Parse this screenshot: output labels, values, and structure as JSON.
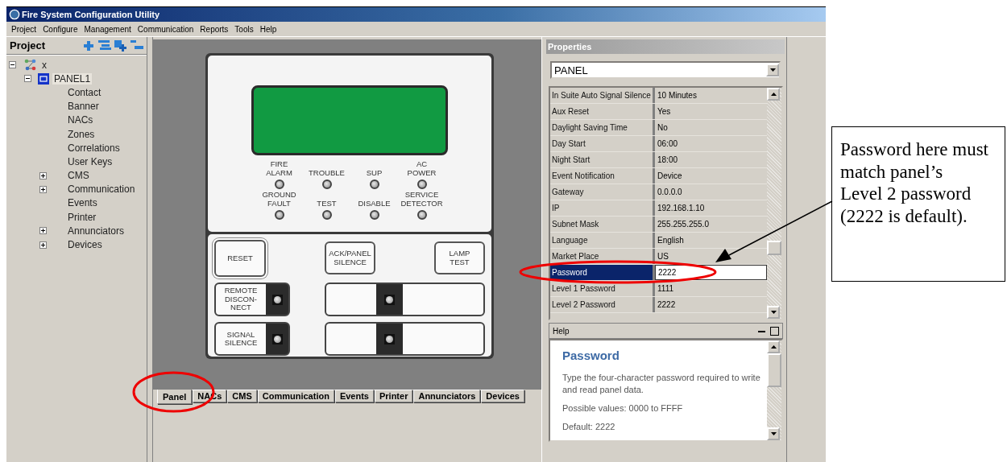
{
  "window": {
    "title": "Fire System Configuration Utility"
  },
  "menu": [
    "Project",
    "Configure",
    "Management",
    "Communication",
    "Reports",
    "Tools",
    "Help"
  ],
  "project_pane": {
    "title": "Project",
    "tree": [
      {
        "label": "x",
        "expanded": true,
        "selected": false,
        "children": [
          {
            "label": "PANEL1",
            "expanded": true,
            "selected": true,
            "children": [
              {
                "label": "Contact",
                "selected": false
              },
              {
                "label": "Banner",
                "selected": false
              },
              {
                "label": "NACs",
                "selected": false
              },
              {
                "label": "Zones",
                "selected": false
              },
              {
                "label": "Correlations",
                "selected": false
              },
              {
                "label": "User Keys",
                "selected": false
              },
              {
                "label": "CMS",
                "expanded": false,
                "selected": false
              },
              {
                "label": "Communication",
                "expanded": false,
                "selected": false
              },
              {
                "label": "Events",
                "selected": false
              },
              {
                "label": "Printer",
                "selected": false
              },
              {
                "label": "Annunciators",
                "expanded": false,
                "selected": false
              },
              {
                "label": "Devices",
                "expanded": false,
                "selected": false
              }
            ]
          }
        ]
      }
    ]
  },
  "panel_front": {
    "leds": [
      {
        "label": "FIRE\nALARM"
      },
      {
        "label": "TROUBLE"
      },
      {
        "label": "SUP"
      },
      {
        "label": "AC\nPOWER"
      },
      {
        "label": "GROUND\nFAULT"
      },
      {
        "label": "TEST"
      },
      {
        "label": "DISABLE"
      },
      {
        "label": "SERVICE\nDETECTOR"
      }
    ],
    "key_rows": [
      [
        {
          "kind": "button",
          "label": "RESET"
        },
        {
          "kind": "button",
          "label": "ACK/PANEL\nSILENCE"
        },
        {
          "kind": "button",
          "label": "LAMP\nTEST"
        }
      ],
      [
        {
          "kind": "led_key",
          "label": "REMOTE\nDISCON-\nNECT"
        },
        {
          "kind": "blank_led_key"
        }
      ],
      [
        {
          "kind": "led_key",
          "label": "SIGNAL\nSILENCE"
        },
        {
          "kind": "blank_led_key"
        }
      ]
    ]
  },
  "tabs": [
    {
      "label": "Panel",
      "selected": true
    },
    {
      "label": "NACs",
      "selected": false
    },
    {
      "label": "CMS",
      "selected": false
    },
    {
      "label": "Communication",
      "selected": false
    },
    {
      "label": "Events",
      "selected": false
    },
    {
      "label": "Printer",
      "selected": false
    },
    {
      "label": "Annunciators",
      "selected": false
    },
    {
      "label": "Devices",
      "selected": false
    }
  ],
  "properties": {
    "title": "Properties",
    "object": "PANEL",
    "rows": [
      {
        "name": "In Suite Auto Signal Silence",
        "value": "10 Minutes",
        "selected": false
      },
      {
        "name": "Aux Reset",
        "value": "Yes",
        "selected": false
      },
      {
        "name": "Daylight Saving Time",
        "value": "No",
        "selected": false
      },
      {
        "name": "Day Start",
        "value": "06:00",
        "selected": false
      },
      {
        "name": "Night Start",
        "value": "18:00",
        "selected": false
      },
      {
        "name": "Event Notification",
        "value": "Device",
        "selected": false
      },
      {
        "name": "Gateway",
        "value": "0.0.0.0",
        "selected": false
      },
      {
        "name": "IP",
        "value": "192.168.1.10",
        "selected": false
      },
      {
        "name": "Subnet Mask",
        "value": "255.255.255.0",
        "selected": false
      },
      {
        "name": "Language",
        "value": "English",
        "selected": false
      },
      {
        "name": "Market Place",
        "value": "US",
        "selected": false
      },
      {
        "name": "Password",
        "value": "2222",
        "selected": true
      },
      {
        "name": "Level 1 Password",
        "value": "1111",
        "selected": false
      },
      {
        "name": "Level 2 Password",
        "value": "2222",
        "selected": false
      }
    ]
  },
  "help": {
    "title": "Help",
    "heading": "Password",
    "paragraphs": [
      "Type the four-character password required to write and read panel data.",
      "Possible values: 0000 to FFFF",
      "Default: 2222"
    ]
  },
  "callout": {
    "text": "Password here must match panel’s Level 2 password (2222 is default)."
  }
}
